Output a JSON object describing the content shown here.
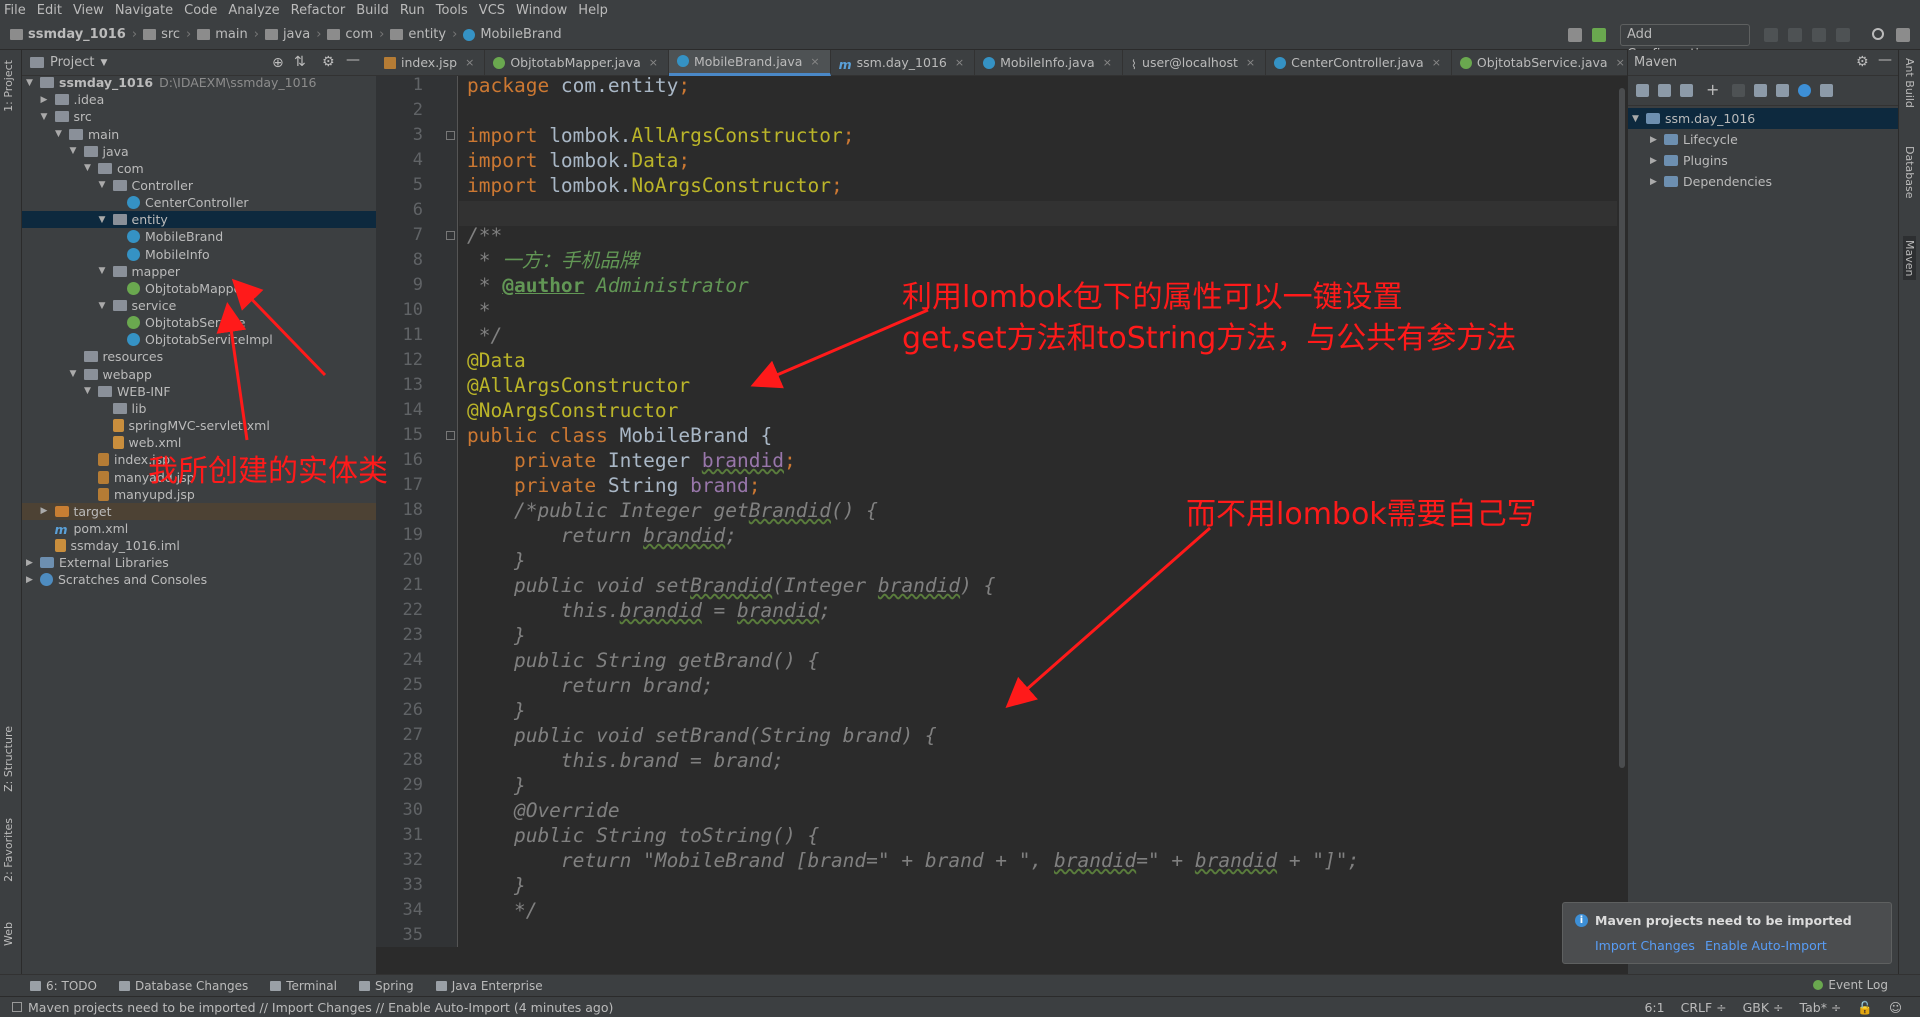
{
  "menu": [
    "File",
    "Edit",
    "View",
    "Navigate",
    "Code",
    "Analyze",
    "Refactor",
    "Build",
    "Run",
    "Tools",
    "VCS",
    "Window",
    "Help"
  ],
  "breadcrumb": [
    "ssmday_1016",
    "src",
    "main",
    "java",
    "com",
    "entity",
    "MobileBrand"
  ],
  "run_config_label": "Add Configuration...",
  "left_strip": {
    "project": "1: Project",
    "structure": "Z: Structure",
    "favorites": "2: Favorites",
    "web": "Web"
  },
  "project_panel": {
    "title": "Project"
  },
  "tree": [
    {
      "label": "ssmday_1016",
      "path": "D:\\IDAEXM\\ssmday_1016",
      "depth": 0,
      "icon": "folder",
      "expanded": true
    },
    {
      "label": ".idea",
      "depth": 1,
      "icon": "folder",
      "expanded": false
    },
    {
      "label": "src",
      "depth": 1,
      "icon": "folder",
      "expanded": true
    },
    {
      "label": "main",
      "depth": 2,
      "icon": "folder",
      "expanded": true
    },
    {
      "label": "java",
      "depth": 3,
      "icon": "folder",
      "expanded": true
    },
    {
      "label": "com",
      "depth": 4,
      "icon": "folder",
      "expanded": true
    },
    {
      "label": "Controller",
      "depth": 5,
      "icon": "folder",
      "expanded": true
    },
    {
      "label": "CenterController",
      "depth": 6,
      "icon": "cls"
    },
    {
      "label": "entity",
      "depth": 5,
      "icon": "folder",
      "expanded": true,
      "selected": true
    },
    {
      "label": "MobileBrand",
      "depth": 6,
      "icon": "cls"
    },
    {
      "label": "MobileInfo",
      "depth": 6,
      "icon": "cls"
    },
    {
      "label": "mapper",
      "depth": 5,
      "icon": "folder",
      "expanded": true
    },
    {
      "label": "ObjtotabMapper",
      "depth": 6,
      "icon": "intf"
    },
    {
      "label": "service",
      "depth": 5,
      "icon": "folder",
      "expanded": true
    },
    {
      "label": "ObjtotabService",
      "depth": 6,
      "icon": "intf"
    },
    {
      "label": "ObjtotabServiceImpl",
      "depth": 6,
      "icon": "cls"
    },
    {
      "label": "resources",
      "depth": 3,
      "icon": "folder"
    },
    {
      "label": "webapp",
      "depth": 3,
      "icon": "folder",
      "expanded": true
    },
    {
      "label": "WEB-INF",
      "depth": 4,
      "icon": "folder",
      "expanded": true
    },
    {
      "label": "lib",
      "depth": 5,
      "icon": "folder"
    },
    {
      "label": "springMVC-servlet.xml",
      "depth": 5,
      "icon": "xml"
    },
    {
      "label": "web.xml",
      "depth": 5,
      "icon": "xml"
    },
    {
      "label": "index.jsp",
      "depth": 4,
      "icon": "jsp"
    },
    {
      "label": "manyadd.jsp",
      "depth": 4,
      "icon": "jsp"
    },
    {
      "label": "manyupd.jsp",
      "depth": 4,
      "icon": "jsp"
    },
    {
      "label": "target",
      "depth": 1,
      "icon": "orange",
      "expanded": false,
      "highlight": true
    },
    {
      "label": "pom.xml",
      "depth": 1,
      "icon": "mvn"
    },
    {
      "label": "ssmday_1016.iml",
      "depth": 1,
      "icon": "xml"
    },
    {
      "label": "External Libraries",
      "depth": 0,
      "icon": "lib",
      "expanded": false
    },
    {
      "label": "Scratches and Consoles",
      "depth": 0,
      "icon": "scr",
      "expanded": false
    }
  ],
  "tabs": [
    {
      "label": "index.jsp",
      "icon": "jsp"
    },
    {
      "label": "ObjtotabMapper.java",
      "icon": "intf"
    },
    {
      "label": "MobileBrand.java",
      "icon": "cls",
      "active": true
    },
    {
      "label": "ssm.day_1016",
      "icon": "mvn"
    },
    {
      "label": "MobileInfo.java",
      "icon": "cls"
    },
    {
      "label": "user@localhost",
      "icon": "db"
    },
    {
      "label": "CenterController.java",
      "icon": "cls"
    },
    {
      "label": "ObjtotabService.java",
      "icon": "intf"
    }
  ],
  "code_lines": [
    [
      [
        "k",
        "package "
      ],
      [
        "p",
        "com.entity"
      ],
      [
        "k",
        ";"
      ]
    ],
    [],
    [
      [
        "k",
        "import "
      ],
      [
        "p",
        "lombok."
      ],
      [
        "an",
        "AllArgsConstructor"
      ],
      [
        "k",
        ";"
      ]
    ],
    [
      [
        "k",
        "import "
      ],
      [
        "p",
        "lombok."
      ],
      [
        "an",
        "Data"
      ],
      [
        "k",
        ";"
      ]
    ],
    [
      [
        "k",
        "import "
      ],
      [
        "p",
        "lombok."
      ],
      [
        "an",
        "NoArgsConstructor"
      ],
      [
        "k",
        ";"
      ]
    ],
    [],
    [
      [
        "cm",
        "/**"
      ]
    ],
    [
      [
        "cm",
        " * "
      ],
      [
        "doc",
        "一方：手机品牌"
      ]
    ],
    [
      [
        "cm",
        " * "
      ],
      [
        "tag",
        "@author"
      ],
      [
        "doc",
        " Administrator"
      ]
    ],
    [
      [
        "cm",
        " *"
      ]
    ],
    [
      [
        "cm",
        " */"
      ]
    ],
    [
      [
        "an",
        "@Data"
      ]
    ],
    [
      [
        "an",
        "@AllArgsConstructor"
      ]
    ],
    [
      [
        "an",
        "@NoArgsConstructor"
      ]
    ],
    [
      [
        "k",
        "public class "
      ],
      [
        "p",
        "MobileBrand {"
      ]
    ],
    [
      [
        "p",
        "    "
      ],
      [
        "k",
        "private "
      ],
      [
        "p",
        "Integer "
      ],
      [
        "fldul",
        "brandid"
      ],
      [
        "k",
        ";"
      ]
    ],
    [
      [
        "p",
        "    "
      ],
      [
        "k",
        "private "
      ],
      [
        "p",
        "String "
      ],
      [
        "fld",
        "brand"
      ],
      [
        "k",
        ";"
      ]
    ],
    [
      [
        "cm",
        "    /*public Integer get"
      ],
      [
        "cmul",
        "Brandid"
      ],
      [
        "cm",
        "() {"
      ]
    ],
    [
      [
        "cm",
        "        return "
      ],
      [
        "cmul",
        "brandid"
      ],
      [
        "cm",
        ";"
      ]
    ],
    [
      [
        "cm",
        "    }"
      ]
    ],
    [
      [
        "cm",
        "    public void set"
      ],
      [
        "cmul",
        "Brandid"
      ],
      [
        "cm",
        "(Integer "
      ],
      [
        "cmul",
        "brandid"
      ],
      [
        "cm",
        ") {"
      ]
    ],
    [
      [
        "cm",
        "        this."
      ],
      [
        "cmul",
        "brandid"
      ],
      [
        "cm",
        " = "
      ],
      [
        "cmul",
        "brandid"
      ],
      [
        "cm",
        ";"
      ]
    ],
    [
      [
        "cm",
        "    }"
      ]
    ],
    [
      [
        "cm",
        "    public String getBrand() {"
      ]
    ],
    [
      [
        "cm",
        "        return brand;"
      ]
    ],
    [
      [
        "cm",
        "    }"
      ]
    ],
    [
      [
        "cm",
        "    public void setBrand(String brand) {"
      ]
    ],
    [
      [
        "cm",
        "        this.brand = brand;"
      ]
    ],
    [
      [
        "cm",
        "    }"
      ]
    ],
    [
      [
        "cm",
        "    @Override"
      ]
    ],
    [
      [
        "cm",
        "    public String toString() {"
      ]
    ],
    [
      [
        "cm",
        "        return \"MobileBrand [brand=\" + brand + \", "
      ],
      [
        "cmul",
        "brandid"
      ],
      [
        "cm",
        "=\" + "
      ],
      [
        "cmul",
        "brandid"
      ],
      [
        "cm",
        " + \"]\";"
      ]
    ],
    [
      [
        "cm",
        "    }"
      ]
    ],
    [
      [
        "cm",
        "    */"
      ]
    ],
    []
  ],
  "annotations": {
    "lombok_line1": "利用lombok包下的属性可以一键设置",
    "lombok_line2": "get,set方法和toString方法，与公共有参方法",
    "entity_note": "我所创建的实体类",
    "manual_note": "而不用lombok需要自己写"
  },
  "maven_panel": {
    "title": "Maven",
    "items": [
      {
        "label": "ssm.day_1016",
        "depth": 0,
        "expanded": true,
        "selected": true
      },
      {
        "label": "Lifecycle",
        "depth": 1
      },
      {
        "label": "Plugins",
        "depth": 1
      },
      {
        "label": "Dependencies",
        "depth": 1
      }
    ]
  },
  "right_strip": {
    "ant": "Ant Build",
    "database": "Database",
    "maven": "Maven"
  },
  "bottom_tabs": [
    "6: TODO",
    "Database Changes",
    "Terminal",
    "Spring",
    "Java Enterprise"
  ],
  "event_log": "Event Log",
  "notification": {
    "title": "Maven projects need to be imported",
    "import": "Import Changes",
    "auto": "Enable Auto-Import"
  },
  "status": {
    "message": "Maven projects need to be imported // Import Changes // Enable Auto-Import (4 minutes ago)",
    "position": "6:1",
    "line_sep": "CRLF ÷",
    "encoding": "GBK ÷",
    "indent": "Tab* ÷"
  },
  "colors": {
    "accent": "#4a88c7",
    "annotation": "#ff1a1a",
    "keyword": "#cc7832",
    "annotation_code": "#bbb529"
  }
}
